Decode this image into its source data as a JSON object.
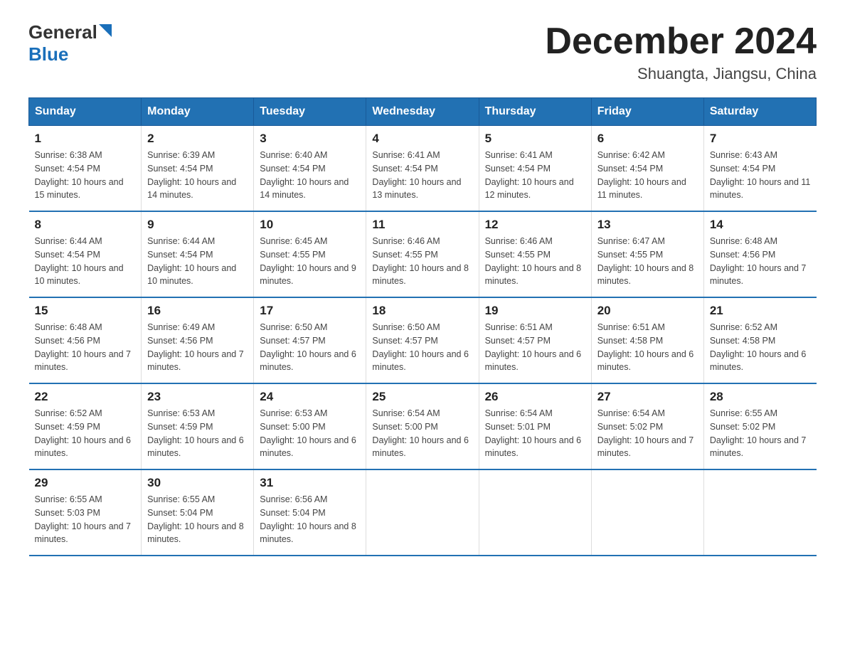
{
  "header": {
    "logo_general": "General",
    "logo_blue": "Blue",
    "month_title": "December 2024",
    "location": "Shuangta, Jiangsu, China"
  },
  "days_of_week": [
    "Sunday",
    "Monday",
    "Tuesday",
    "Wednesday",
    "Thursday",
    "Friday",
    "Saturday"
  ],
  "weeks": [
    [
      {
        "day": "1",
        "sunrise": "6:38 AM",
        "sunset": "4:54 PM",
        "daylight": "10 hours and 15 minutes."
      },
      {
        "day": "2",
        "sunrise": "6:39 AM",
        "sunset": "4:54 PM",
        "daylight": "10 hours and 14 minutes."
      },
      {
        "day": "3",
        "sunrise": "6:40 AM",
        "sunset": "4:54 PM",
        "daylight": "10 hours and 14 minutes."
      },
      {
        "day": "4",
        "sunrise": "6:41 AM",
        "sunset": "4:54 PM",
        "daylight": "10 hours and 13 minutes."
      },
      {
        "day": "5",
        "sunrise": "6:41 AM",
        "sunset": "4:54 PM",
        "daylight": "10 hours and 12 minutes."
      },
      {
        "day": "6",
        "sunrise": "6:42 AM",
        "sunset": "4:54 PM",
        "daylight": "10 hours and 11 minutes."
      },
      {
        "day": "7",
        "sunrise": "6:43 AM",
        "sunset": "4:54 PM",
        "daylight": "10 hours and 11 minutes."
      }
    ],
    [
      {
        "day": "8",
        "sunrise": "6:44 AM",
        "sunset": "4:54 PM",
        "daylight": "10 hours and 10 minutes."
      },
      {
        "day": "9",
        "sunrise": "6:44 AM",
        "sunset": "4:54 PM",
        "daylight": "10 hours and 10 minutes."
      },
      {
        "day": "10",
        "sunrise": "6:45 AM",
        "sunset": "4:55 PM",
        "daylight": "10 hours and 9 minutes."
      },
      {
        "day": "11",
        "sunrise": "6:46 AM",
        "sunset": "4:55 PM",
        "daylight": "10 hours and 8 minutes."
      },
      {
        "day": "12",
        "sunrise": "6:46 AM",
        "sunset": "4:55 PM",
        "daylight": "10 hours and 8 minutes."
      },
      {
        "day": "13",
        "sunrise": "6:47 AM",
        "sunset": "4:55 PM",
        "daylight": "10 hours and 8 minutes."
      },
      {
        "day": "14",
        "sunrise": "6:48 AM",
        "sunset": "4:56 PM",
        "daylight": "10 hours and 7 minutes."
      }
    ],
    [
      {
        "day": "15",
        "sunrise": "6:48 AM",
        "sunset": "4:56 PM",
        "daylight": "10 hours and 7 minutes."
      },
      {
        "day": "16",
        "sunrise": "6:49 AM",
        "sunset": "4:56 PM",
        "daylight": "10 hours and 7 minutes."
      },
      {
        "day": "17",
        "sunrise": "6:50 AM",
        "sunset": "4:57 PM",
        "daylight": "10 hours and 6 minutes."
      },
      {
        "day": "18",
        "sunrise": "6:50 AM",
        "sunset": "4:57 PM",
        "daylight": "10 hours and 6 minutes."
      },
      {
        "day": "19",
        "sunrise": "6:51 AM",
        "sunset": "4:57 PM",
        "daylight": "10 hours and 6 minutes."
      },
      {
        "day": "20",
        "sunrise": "6:51 AM",
        "sunset": "4:58 PM",
        "daylight": "10 hours and 6 minutes."
      },
      {
        "day": "21",
        "sunrise": "6:52 AM",
        "sunset": "4:58 PM",
        "daylight": "10 hours and 6 minutes."
      }
    ],
    [
      {
        "day": "22",
        "sunrise": "6:52 AM",
        "sunset": "4:59 PM",
        "daylight": "10 hours and 6 minutes."
      },
      {
        "day": "23",
        "sunrise": "6:53 AM",
        "sunset": "4:59 PM",
        "daylight": "10 hours and 6 minutes."
      },
      {
        "day": "24",
        "sunrise": "6:53 AM",
        "sunset": "5:00 PM",
        "daylight": "10 hours and 6 minutes."
      },
      {
        "day": "25",
        "sunrise": "6:54 AM",
        "sunset": "5:00 PM",
        "daylight": "10 hours and 6 minutes."
      },
      {
        "day": "26",
        "sunrise": "6:54 AM",
        "sunset": "5:01 PM",
        "daylight": "10 hours and 6 minutes."
      },
      {
        "day": "27",
        "sunrise": "6:54 AM",
        "sunset": "5:02 PM",
        "daylight": "10 hours and 7 minutes."
      },
      {
        "day": "28",
        "sunrise": "6:55 AM",
        "sunset": "5:02 PM",
        "daylight": "10 hours and 7 minutes."
      }
    ],
    [
      {
        "day": "29",
        "sunrise": "6:55 AM",
        "sunset": "5:03 PM",
        "daylight": "10 hours and 7 minutes."
      },
      {
        "day": "30",
        "sunrise": "6:55 AM",
        "sunset": "5:04 PM",
        "daylight": "10 hours and 8 minutes."
      },
      {
        "day": "31",
        "sunrise": "6:56 AM",
        "sunset": "5:04 PM",
        "daylight": "10 hours and 8 minutes."
      },
      null,
      null,
      null,
      null
    ]
  ]
}
